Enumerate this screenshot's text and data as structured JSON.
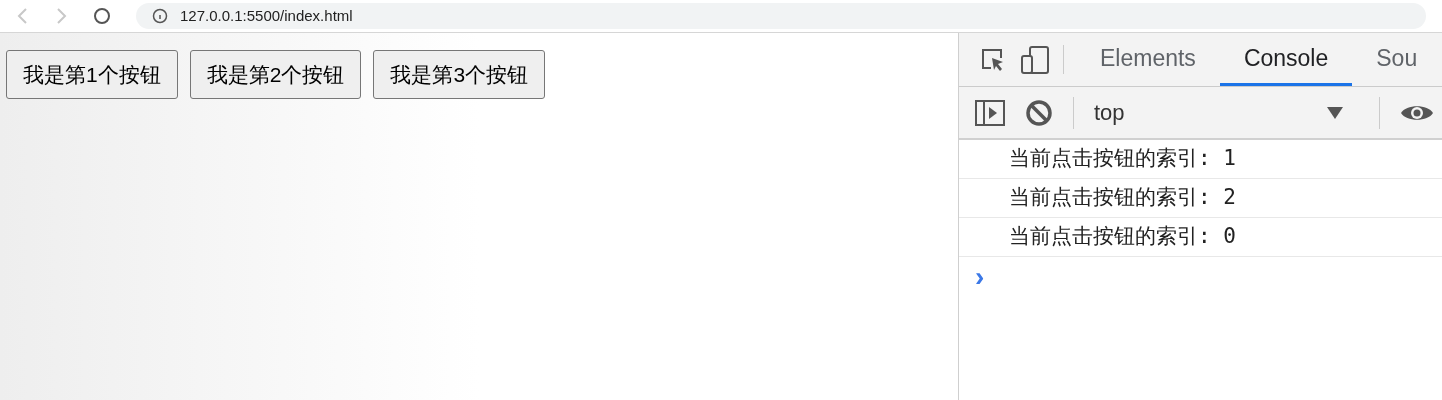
{
  "browser": {
    "url": "127.0.0.1:5500/index.html"
  },
  "page": {
    "buttons": [
      "我是第1个按钮",
      "我是第2个按钮",
      "我是第3个按钮"
    ]
  },
  "devtools": {
    "tabs": [
      {
        "label": "Elements",
        "selected": false
      },
      {
        "label": "Console",
        "selected": true
      },
      {
        "label": "Sou",
        "selected": false
      }
    ],
    "context": "top",
    "console_lines": [
      "当前点击按钮的索引: 1",
      "当前点击按钮的索引: 2",
      "当前点击按钮的索引: 0"
    ],
    "prompt": "›"
  }
}
